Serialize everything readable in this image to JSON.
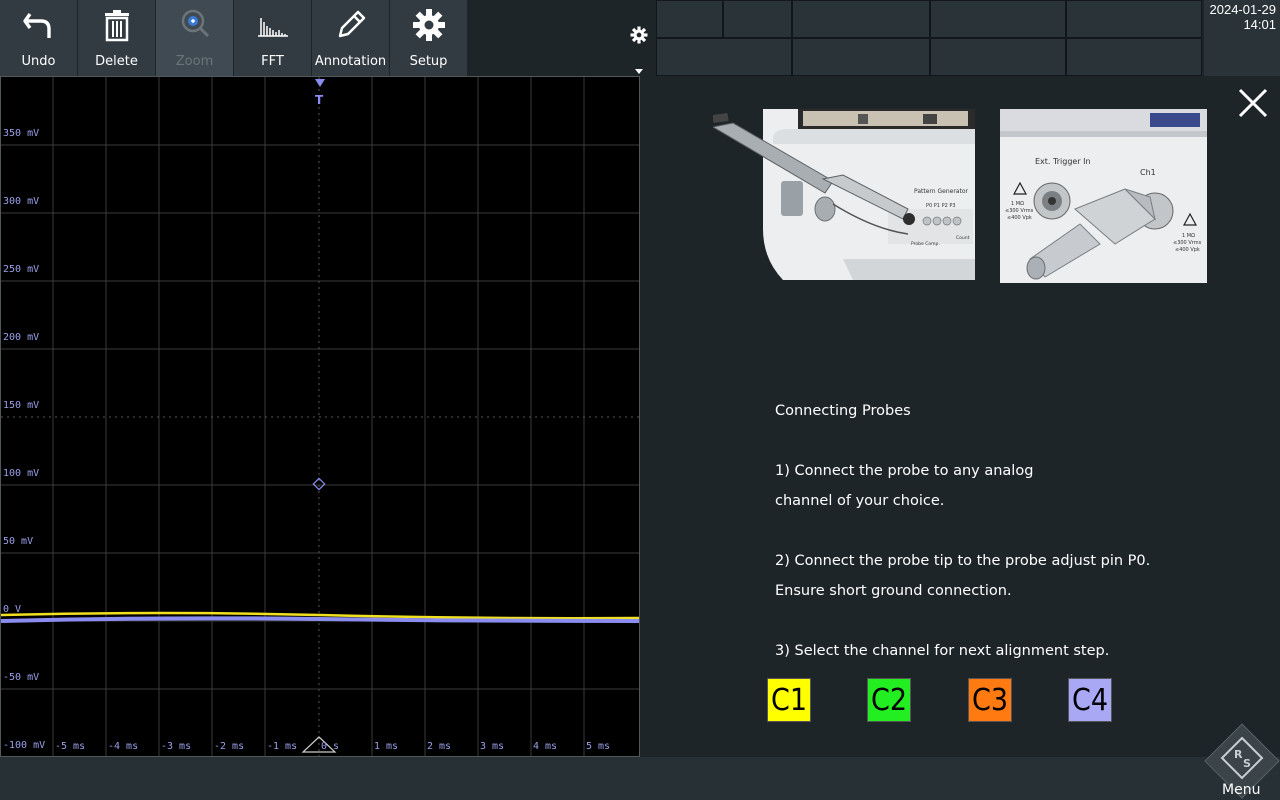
{
  "toolbar": {
    "undo_label": "Undo",
    "delete_label": "Delete",
    "zoom_label": "Zoom",
    "fft_label": "FFT",
    "annotation_label": "Annotation",
    "setup_label": "Setup"
  },
  "datetime": {
    "date": "2024-01-29",
    "time": "14:01"
  },
  "scope": {
    "y_labels": [
      "350 mV",
      "300 mV",
      "250 mV",
      "200 mV",
      "150 mV",
      "100 mV",
      "50 mV",
      "0 V",
      "-50 mV",
      "-100 mV"
    ],
    "x_labels": [
      "-5 ms",
      "-4 ms",
      "-3 ms",
      "-2 ms",
      "-1 ms",
      "0 s",
      "1 ms",
      "2 ms",
      "3 ms",
      "4 ms",
      "5 ms"
    ],
    "trigger_marker": "T",
    "colors": {
      "trace_c1": "#f0e020",
      "trace_c4": "#8a8cf0",
      "grid": "#3a3a3a",
      "label": "#9aa0e8"
    }
  },
  "help": {
    "title": "Connecting Probes",
    "step1_line1": "1)  Connect the probe to any analog",
    "step1_line2": "channel of your choice.",
    "step2_line1": "2)  Connect the probe tip to the probe adjust pin P0.",
    "step2_line2": "Ensure short ground connection.",
    "step3": "3) Select the channel for next alignment step."
  },
  "photos": {
    "left": {
      "generator_label": "Pattern Generator",
      "pins": "P0  P1  P2  P3",
      "comp_label": "Probe Comp.",
      "count_label": "Count"
    },
    "right": {
      "trigger_label": "Ext. Trigger In",
      "ch_label": "Ch1",
      "spec_left": "1 MΩ\n≤300 Vrms\n≤400 Vpk",
      "spec_right": "1 MΩ\n≤300 Vrms\n≤400 Vpk"
    }
  },
  "channels": [
    {
      "label": "C1",
      "color": "#ffff00"
    },
    {
      "label": "C2",
      "color": "#22ee22"
    },
    {
      "label": "C3",
      "color": "#ff7a10"
    },
    {
      "label": "C4",
      "color": "#a9a8f4"
    }
  ],
  "menu": {
    "label": "Menu",
    "logo": "R&S"
  }
}
